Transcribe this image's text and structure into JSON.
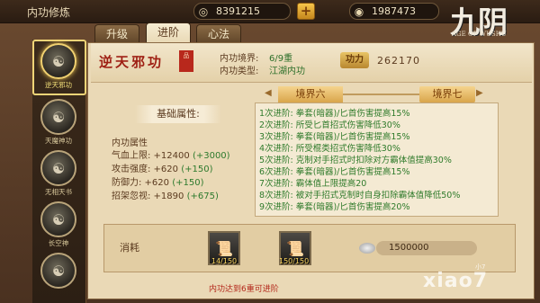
{
  "window": {
    "title": "内功修炼"
  },
  "currency": {
    "silver": "8391215",
    "gold": "1987473",
    "silver_icon": "silver-coin-icon",
    "gold_icon": "gold-ingot-icon"
  },
  "logo": {
    "main": "九阴",
    "sub": "AGE OF WUSHU"
  },
  "tabs": [
    {
      "label": "升级"
    },
    {
      "label": "进阶"
    },
    {
      "label": "心法"
    }
  ],
  "skills": [
    {
      "label": "逆天邪功",
      "active": true
    },
    {
      "label": "天魔神功",
      "active": false
    },
    {
      "label": "无相天书",
      "active": false
    },
    {
      "label": "长空神",
      "active": false
    }
  ],
  "skill": {
    "name": "逆天邪功",
    "seal": "品",
    "realm_label": "内功境界:",
    "realm_value": "6/9重",
    "type_label": "内功类型:",
    "type_value": "江湖内功",
    "power_label": "功力",
    "power_value": "262170"
  },
  "attributes": {
    "title": "基础属性:",
    "section": "内功属性",
    "lines": [
      {
        "label": "气血上限: +12400",
        "bonus": "(+3000)"
      },
      {
        "label": "攻击强度: +620",
        "bonus": "(+150)"
      },
      {
        "label": "防御力: +620",
        "bonus": "(+150)"
      },
      {
        "label": "招架忽视: +1890",
        "bonus": "(+675)"
      }
    ]
  },
  "realms": {
    "current": "境界六",
    "next": "境界七"
  },
  "advances": [
    "1次进阶: 拳套(暗器)/匕首伤害提高15%",
    "2次进阶: 所受匕首招式伤害降低30%",
    "3次进阶: 拳套(暗器)/匕首伤害提高15%",
    "4次进阶: 所受棍类招式伤害降低30%",
    "5次进阶: 克制对手招式时扣除对方霸体值提高30%",
    "6次进阶: 拳套(暗器)/匕首伤害提高15%",
    "7次进阶: 霸体值上限提高20",
    "8次进阶: 被对手招式克制时自身扣除霸体值降低50%",
    "9次进阶: 拳套(暗器)/匕首伤害提高20%"
  ],
  "cost": {
    "label": "消耗",
    "items": [
      {
        "icon": "scroll-book-icon",
        "count": "14/150"
      },
      {
        "icon": "scroll-book-icon",
        "count": "150/150"
      }
    ],
    "silver": "1500000"
  },
  "footer": {
    "note": "内功达到6重可进阶"
  },
  "watermark": {
    "main": "xiao7",
    "sub": "小7"
  }
}
